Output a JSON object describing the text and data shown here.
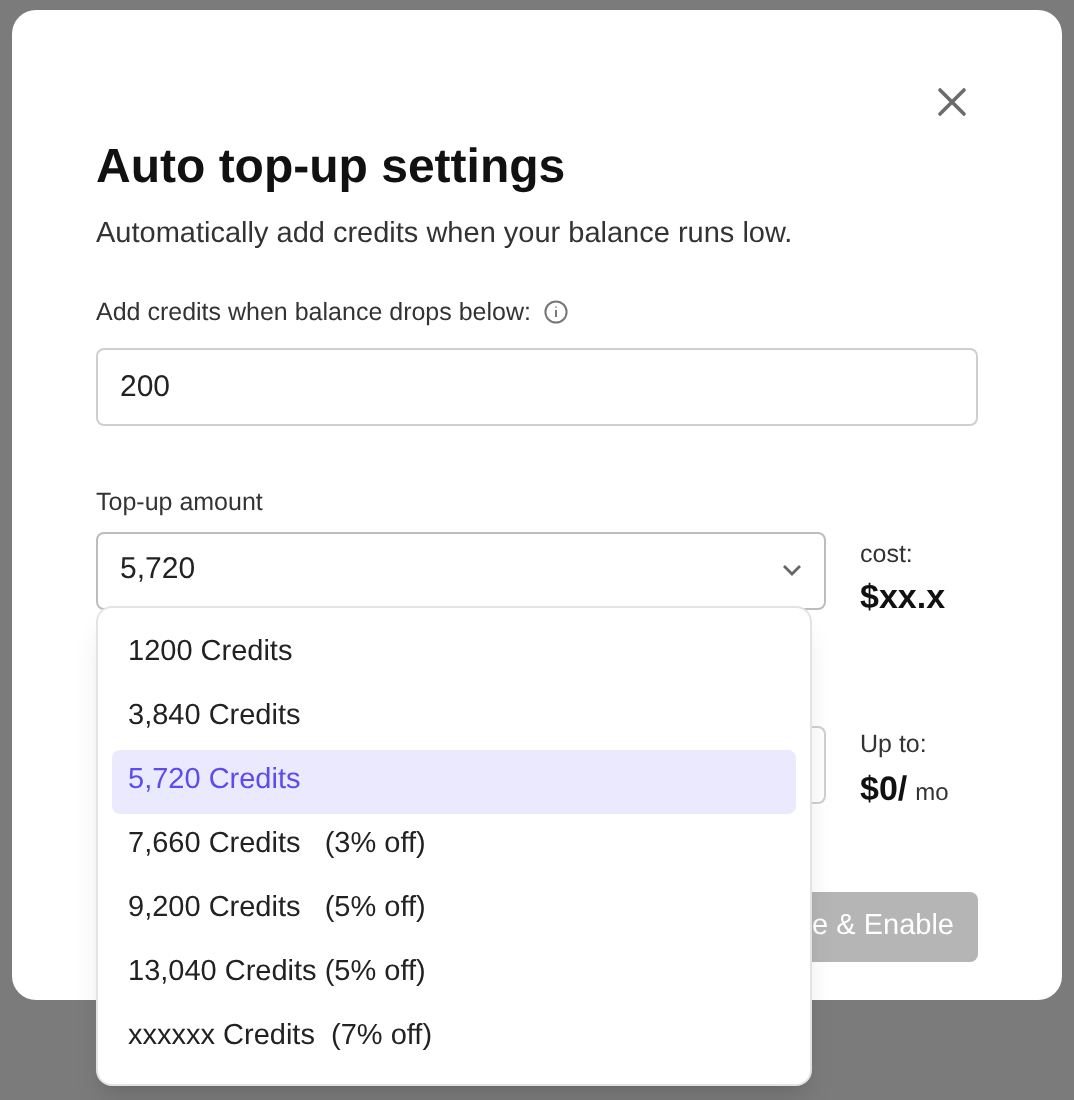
{
  "dialog": {
    "title": "Auto top-up settings",
    "subtitle": "Automatically add credits when your balance runs low.",
    "threshold": {
      "label": "Add credits when balance drops below:",
      "value": "200"
    },
    "amount": {
      "label": "Top-up amount",
      "value": "5,720",
      "expanded": true,
      "options": [
        {
          "label": "1200 Credits",
          "selected": false
        },
        {
          "label": "3,840 Credits",
          "selected": false
        },
        {
          "label": "5,720 Credits",
          "selected": true
        },
        {
          "label": "7,660 Credits   (3% off)",
          "selected": false
        },
        {
          "label": "9,200 Credits   (5% off)",
          "selected": false
        },
        {
          "label": "13,040 Credits (5% off)",
          "selected": false
        },
        {
          "label": "xxxxxx Credits  (7% off)",
          "selected": false
        }
      ]
    },
    "cost": {
      "label": "cost:",
      "value": "$xx.x"
    },
    "limit": {
      "label": "Up to:",
      "value": "$0/",
      "unit": "mo"
    },
    "button": {
      "label": "e & Enable",
      "disabled": true
    }
  }
}
